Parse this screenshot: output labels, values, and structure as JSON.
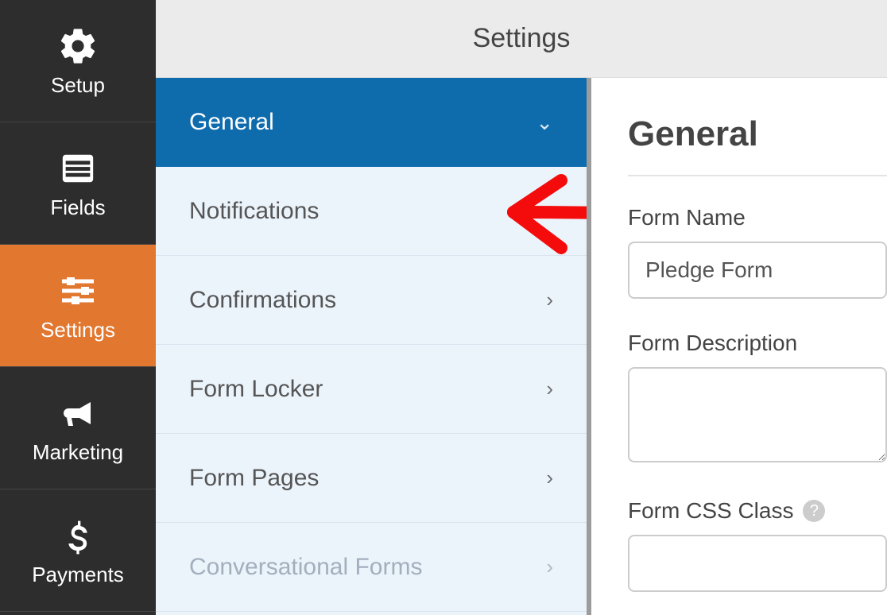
{
  "sidebar": {
    "items": [
      {
        "label": "Setup",
        "icon": "gear"
      },
      {
        "label": "Fields",
        "icon": "list"
      },
      {
        "label": "Settings",
        "icon": "sliders"
      },
      {
        "label": "Marketing",
        "icon": "bullhorn"
      },
      {
        "label": "Payments",
        "icon": "dollar"
      }
    ],
    "active": "Settings"
  },
  "header": {
    "title": "Settings"
  },
  "submenu": {
    "items": [
      {
        "label": "General",
        "expanded": true
      },
      {
        "label": "Notifications"
      },
      {
        "label": "Confirmations"
      },
      {
        "label": "Form Locker"
      },
      {
        "label": "Form Pages"
      },
      {
        "label": "Conversational Forms",
        "dim": true
      }
    ]
  },
  "panel": {
    "title": "General",
    "form_name_label": "Form Name",
    "form_name_value": "Pledge Form",
    "form_description_label": "Form Description",
    "form_css_label": "Form CSS Class"
  }
}
